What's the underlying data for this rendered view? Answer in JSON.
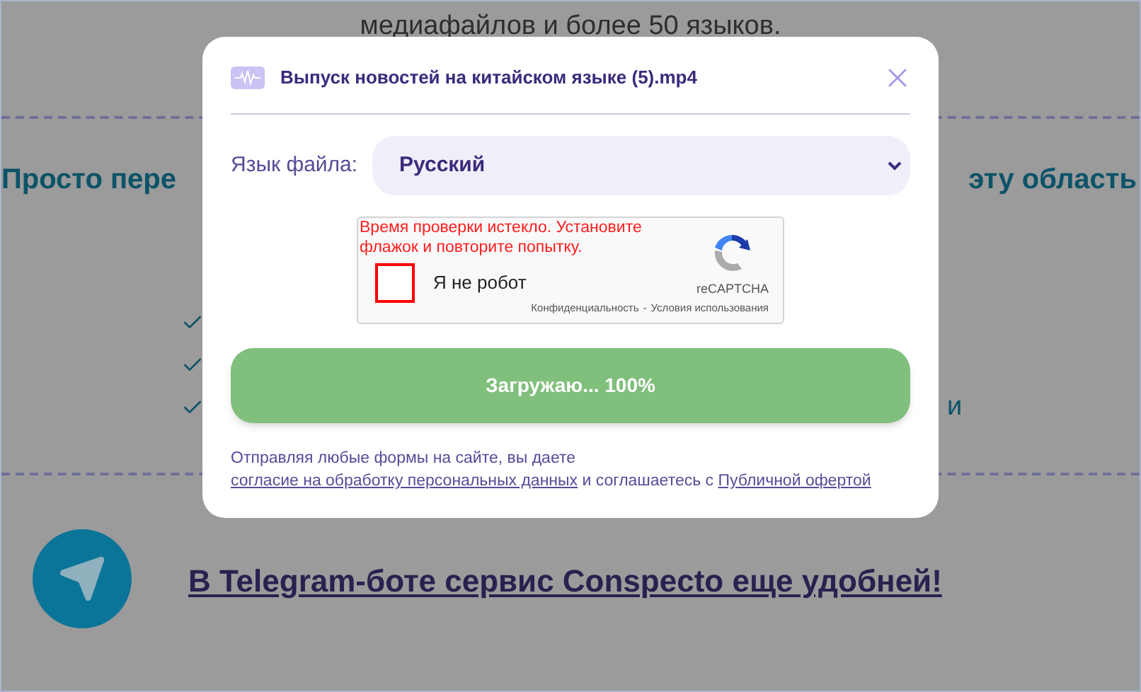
{
  "background_page": {
    "intro_text": "медиафайлов и более 50 языков.",
    "heading_left": "Просто пере",
    "heading_right": "эту область",
    "feature_trailing_text": "и",
    "telegram_link": "В Telegram-боте сервис Conspecto еще удобней!"
  },
  "modal": {
    "title": "Выпуск новостей на китайском языке (5).mp4",
    "language": {
      "label": "Язык файла:",
      "value": "Русский"
    },
    "captcha": {
      "error": "Время проверки истекло. Установите флажок и повторите попытку.",
      "checkbox_label": "Я не робот",
      "checked": false,
      "brand": "reCAPTCHA",
      "privacy_link": "Конфиденциальность",
      "separator": "-",
      "terms_link": "Условия использования"
    },
    "upload_button": {
      "label": "Загружаю... 100%"
    },
    "consent": {
      "before": "Отправляя любые формы на сайте, вы даете ",
      "link_1": "согласие на обработку персональных данных",
      "middle": " и соглашаетесь с ",
      "link_2": "Публичной офертой"
    }
  }
}
